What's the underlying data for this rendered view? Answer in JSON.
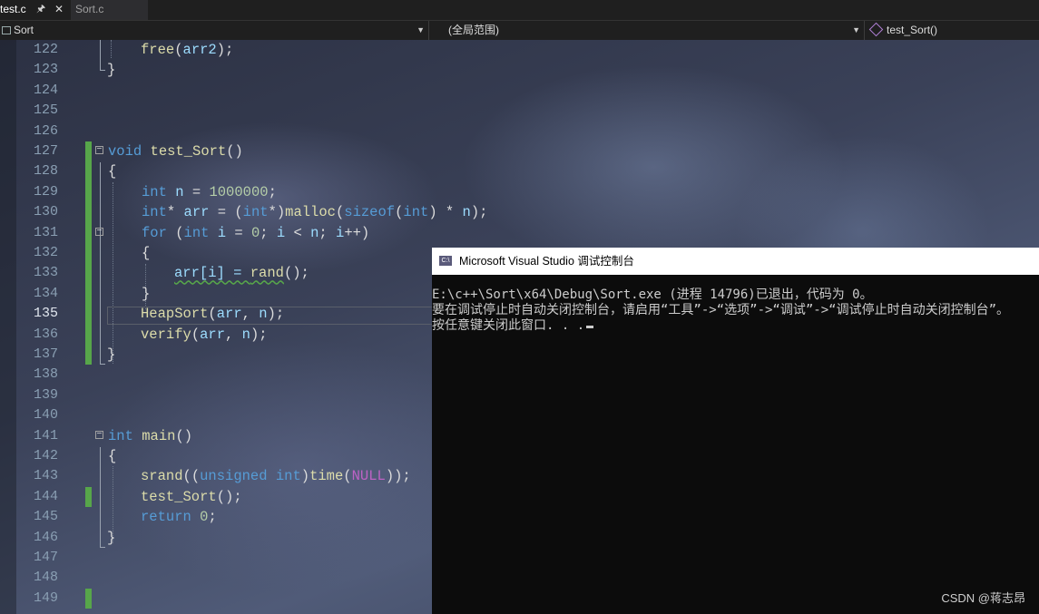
{
  "tabs": [
    {
      "label": "test.c",
      "pin_icon": "pin-icon",
      "close_icon": "close-icon"
    },
    {
      "label": "Sort.c"
    }
  ],
  "navbar": {
    "project": "Sort",
    "scope": "(全局范围)",
    "member": "test_Sort()"
  },
  "editor": {
    "current_line": 135,
    "lines": [
      {
        "no": "122",
        "text": "free(arr2);"
      },
      {
        "no": "123",
        "text": "}"
      },
      {
        "no": "124",
        "text": ""
      },
      {
        "no": "125",
        "text": ""
      },
      {
        "no": "126",
        "text": ""
      },
      {
        "no": "127",
        "text": "void test_Sort()"
      },
      {
        "no": "128",
        "text": "{"
      },
      {
        "no": "129",
        "text": "int n = 1000000;"
      },
      {
        "no": "130",
        "text": "int* arr = (int*)malloc(sizeof(int) * n);"
      },
      {
        "no": "131",
        "text": "for (int i = 0; i < n; i++)"
      },
      {
        "no": "132",
        "text": "{"
      },
      {
        "no": "133",
        "text": "arr[i] = rand();"
      },
      {
        "no": "134",
        "text": "}"
      },
      {
        "no": "135",
        "text": "HeapSort(arr, n);"
      },
      {
        "no": "136",
        "text": "verify(arr, n);"
      },
      {
        "no": "137",
        "text": "}"
      },
      {
        "no": "138",
        "text": ""
      },
      {
        "no": "139",
        "text": ""
      },
      {
        "no": "140",
        "text": ""
      },
      {
        "no": "141",
        "text": "int main()"
      },
      {
        "no": "142",
        "text": "{"
      },
      {
        "no": "143",
        "text": "srand((unsigned int)time(NULL));"
      },
      {
        "no": "144",
        "text": "test_Sort();"
      },
      {
        "no": "145",
        "text": "return 0;"
      },
      {
        "no": "146",
        "text": "}"
      },
      {
        "no": "147",
        "text": ""
      },
      {
        "no": "148",
        "text": ""
      },
      {
        "no": "149",
        "text": ""
      }
    ]
  },
  "console": {
    "title": "Microsoft Visual Studio 调试控制台",
    "lines": [
      "E:\\c++\\Sort\\x64\\Debug\\Sort.exe (进程 14796)已退出，代码为 0。",
      "要在调试停止时自动关闭控制台，请启用“工具”->“选项”->“调试”->“调试停止时自动关闭控制台”。",
      "按任意键关闭此窗口. . ."
    ]
  },
  "watermark": "CSDN @蒋志昂",
  "colors": {
    "keyword": "#569cd6",
    "function": "#dcdcaa",
    "number": "#b5cea8",
    "variable": "#9cdcfe",
    "macro": "#bd63c5",
    "change_bar": "#57a64a",
    "active_tab_underline": "#0e70c0"
  }
}
